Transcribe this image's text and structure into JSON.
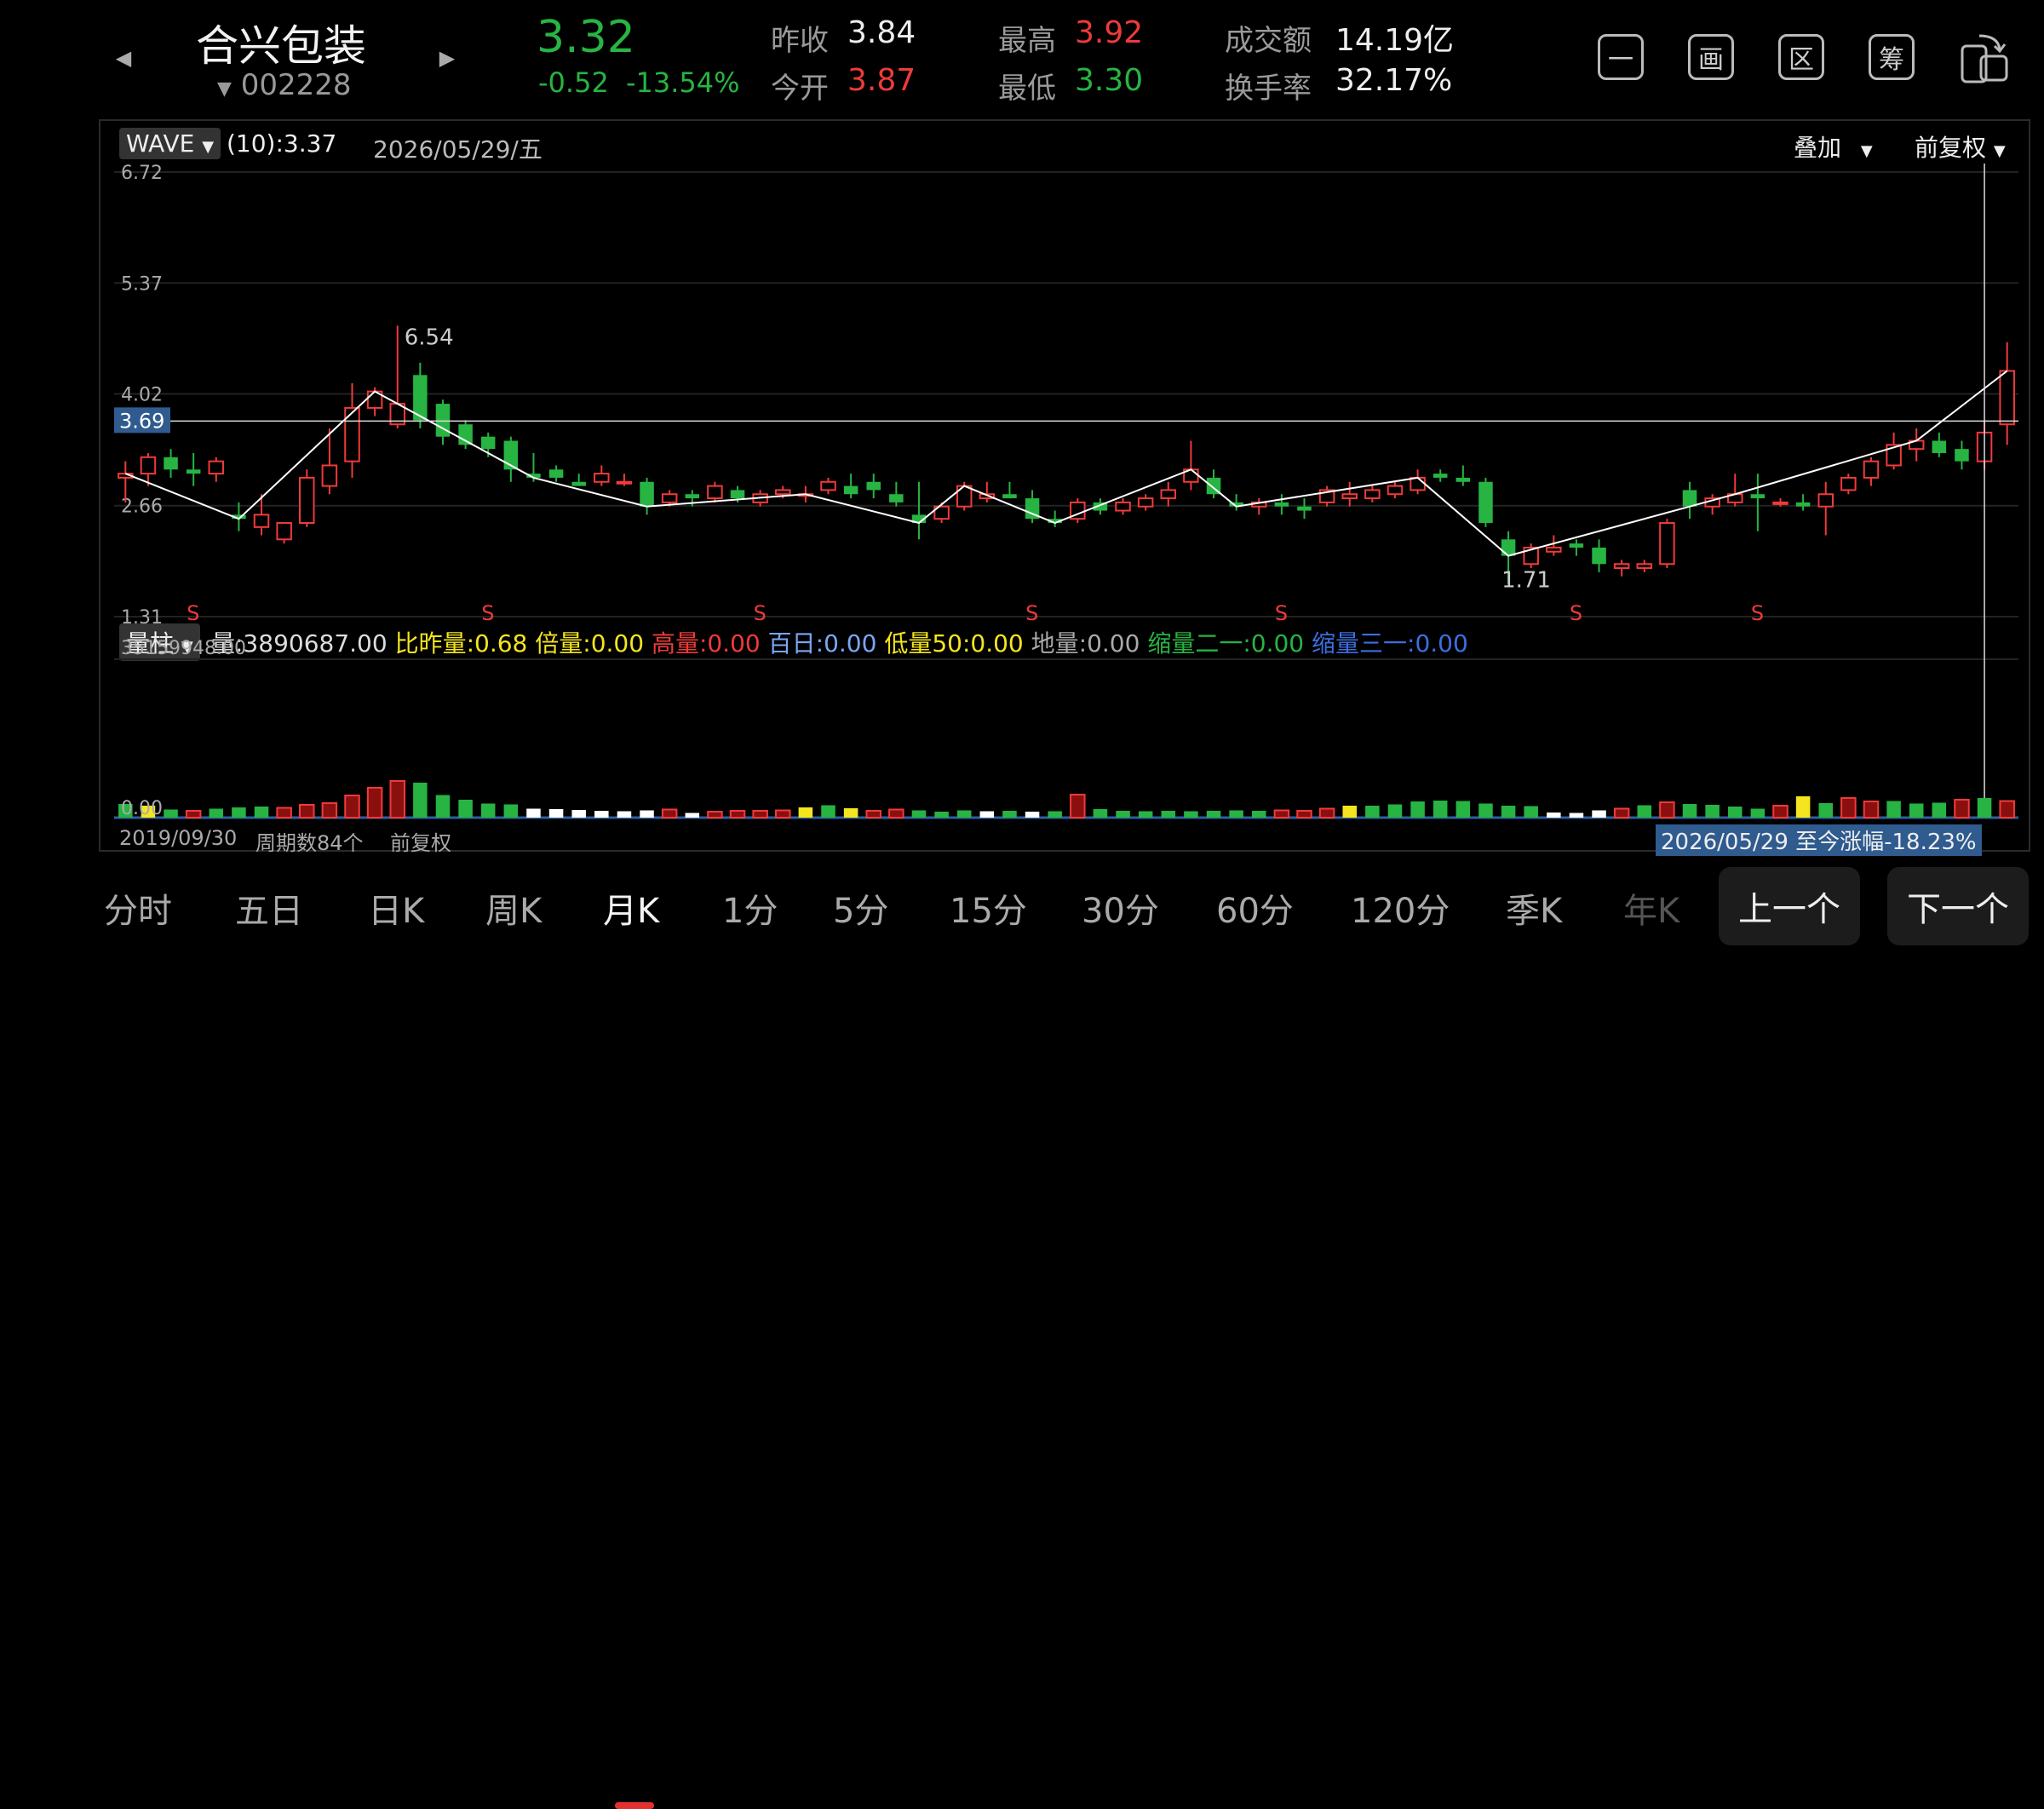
{
  "stock": {
    "name": "合兴包装",
    "code": "002228",
    "price": "3.32",
    "change": "-0.52",
    "change_pct": "-13.54%"
  },
  "quote": {
    "prev_close_label": "昨收",
    "prev_close": "3.84",
    "open_label": "今开",
    "open": "3.87",
    "high_label": "最高",
    "high": "3.92",
    "low_label": "最低",
    "low": "3.30",
    "turnover_label": "成交额",
    "turnover": "14.19亿",
    "turnover_rate_label": "换手率",
    "turnover_rate": "32.17%"
  },
  "toolbar": [
    "一",
    "画",
    "区",
    "筹"
  ],
  "colors": {
    "up": "#f03a3a",
    "down": "#27b443",
    "bg": "#000000",
    "zigzag": "#ffffff",
    "yellow": "#f5e51e",
    "label_bg": "#2f5b8f"
  },
  "main": {
    "indicator": "WAVE",
    "indicator_value": "(10):3.37",
    "date": "2026/05/29/五",
    "overlay_label": "叠加",
    "adjust_label": "前复权",
    "yticks": [
      "6.72",
      "5.37",
      "4.02",
      "2.66",
      "1.31"
    ],
    "crosshair_price": "3.69",
    "high_annotation": "6.54",
    "low_annotation": "1.71",
    "s_marker": "S"
  },
  "volume": {
    "selector": "量柱",
    "items": [
      {
        "text": "量:3890687.00",
        "color": "#dddddd"
      },
      {
        "text": "比昨量:0.68",
        "color": "#f5e51e"
      },
      {
        "text": "倍量:0.00",
        "color": "#f5e51e"
      },
      {
        "text": "高量:0.00",
        "color": "#f03a3a"
      },
      {
        "text": "百日:0.00",
        "color": "#7aa7f5"
      },
      {
        "text": "低量50:0.00",
        "color": "#f5e51e"
      },
      {
        "text": "地量:0.00",
        "color": "#aaaaaa"
      },
      {
        "text": "缩量二一:0.00",
        "color": "#27b443"
      },
      {
        "text": "缩量三一:0.00",
        "color": "#3b6fe0"
      }
    ],
    "max_label": "35159948.00",
    "zero_label": "0.00"
  },
  "footer": {
    "start_date": "2019/09/30",
    "periods": "周期数84个",
    "adjust": "前复权",
    "range_note": "2026/05/29 至今涨幅-18.23%"
  },
  "tabs": [
    {
      "label": "分时",
      "active": false
    },
    {
      "label": "五日",
      "active": false
    },
    {
      "label": "日K",
      "active": false
    },
    {
      "label": "周K",
      "active": false
    },
    {
      "label": "月K",
      "active": true
    },
    {
      "label": "1分",
      "active": false
    },
    {
      "label": "5分",
      "active": false
    },
    {
      "label": "15分",
      "active": false
    },
    {
      "label": "30分",
      "active": false
    },
    {
      "label": "60分",
      "active": false
    },
    {
      "label": "120分",
      "active": false
    },
    {
      "label": "季K",
      "active": false
    },
    {
      "label": "年K",
      "active": false
    }
  ],
  "buttons": {
    "prev": "上一个",
    "next": "下一个"
  },
  "chart_data": {
    "type": "candlestick",
    "ylim": [
      1.31,
      6.72
    ],
    "volume_ylim": [
      0,
      35159948
    ],
    "candles": [
      [
        3.0,
        3.2,
        2.7,
        3.05
      ],
      [
        3.05,
        3.3,
        2.9,
        3.25
      ],
      [
        3.25,
        3.35,
        3.0,
        3.1
      ],
      [
        3.1,
        3.3,
        2.9,
        3.05
      ],
      [
        3.05,
        3.25,
        2.95,
        3.2
      ],
      [
        2.55,
        2.7,
        2.35,
        2.5
      ],
      [
        2.4,
        2.8,
        2.3,
        2.55
      ],
      [
        2.25,
        2.45,
        2.2,
        2.45
      ],
      [
        2.45,
        3.1,
        2.4,
        3.0
      ],
      [
        2.9,
        3.6,
        2.8,
        3.15
      ],
      [
        3.2,
        4.15,
        3.0,
        3.85
      ],
      [
        3.85,
        4.1,
        3.75,
        4.05
      ],
      [
        3.65,
        4.85,
        3.6,
        3.9
      ],
      [
        4.25,
        4.4,
        3.6,
        3.7
      ],
      [
        3.9,
        3.95,
        3.4,
        3.5
      ],
      [
        3.65,
        3.7,
        3.35,
        3.4
      ],
      [
        3.5,
        3.55,
        3.25,
        3.35
      ],
      [
        3.45,
        3.5,
        2.95,
        3.1
      ],
      [
        3.05,
        3.3,
        2.95,
        3.0
      ],
      [
        3.1,
        3.15,
        2.95,
        3.0
      ],
      [
        2.95,
        3.05,
        2.9,
        2.9
      ],
      [
        2.95,
        3.15,
        2.9,
        3.05
      ],
      [
        2.95,
        3.05,
        2.9,
        2.95
      ],
      [
        2.95,
        3.0,
        2.55,
        2.65
      ],
      [
        2.7,
        2.85,
        2.65,
        2.8
      ],
      [
        2.8,
        2.85,
        2.65,
        2.75
      ],
      [
        2.75,
        2.95,
        2.7,
        2.9
      ],
      [
        2.85,
        2.9,
        2.7,
        2.75
      ],
      [
        2.7,
        2.85,
        2.65,
        2.8
      ],
      [
        2.8,
        2.9,
        2.75,
        2.85
      ],
      [
        2.8,
        2.9,
        2.7,
        2.8
      ],
      [
        2.85,
        3.0,
        2.8,
        2.95
      ],
      [
        2.9,
        3.05,
        2.75,
        2.8
      ],
      [
        2.95,
        3.05,
        2.75,
        2.85
      ],
      [
        2.8,
        2.95,
        2.65,
        2.7
      ],
      [
        2.55,
        2.95,
        2.25,
        2.45
      ],
      [
        2.5,
        2.7,
        2.45,
        2.65
      ],
      [
        2.65,
        2.95,
        2.6,
        2.9
      ],
      [
        2.75,
        2.95,
        2.7,
        2.8
      ],
      [
        2.8,
        2.95,
        2.75,
        2.75
      ],
      [
        2.75,
        2.85,
        2.45,
        2.5
      ],
      [
        2.5,
        2.6,
        2.4,
        2.45
      ],
      [
        2.5,
        2.75,
        2.45,
        2.7
      ],
      [
        2.7,
        2.75,
        2.55,
        2.6
      ],
      [
        2.6,
        2.75,
        2.55,
        2.7
      ],
      [
        2.65,
        2.8,
        2.6,
        2.75
      ],
      [
        2.75,
        2.95,
        2.65,
        2.85
      ],
      [
        2.95,
        3.45,
        2.85,
        3.1
      ],
      [
        3.0,
        3.1,
        2.75,
        2.8
      ],
      [
        2.7,
        2.8,
        2.6,
        2.65
      ],
      [
        2.65,
        2.75,
        2.55,
        2.7
      ],
      [
        2.7,
        2.8,
        2.55,
        2.65
      ],
      [
        2.65,
        2.75,
        2.5,
        2.6
      ],
      [
        2.7,
        2.9,
        2.65,
        2.85
      ],
      [
        2.75,
        2.95,
        2.65,
        2.8
      ],
      [
        2.75,
        2.9,
        2.7,
        2.85
      ],
      [
        2.8,
        2.95,
        2.75,
        2.9
      ],
      [
        2.85,
        3.1,
        2.8,
        3.0
      ],
      [
        3.05,
        3.1,
        2.95,
        3.0
      ],
      [
        3.0,
        3.15,
        2.9,
        2.95
      ],
      [
        2.95,
        3.0,
        2.4,
        2.45
      ],
      [
        2.25,
        2.35,
        1.71,
        2.05
      ],
      [
        1.95,
        2.2,
        1.9,
        2.15
      ],
      [
        2.1,
        2.3,
        2.05,
        2.15
      ],
      [
        2.2,
        2.25,
        2.05,
        2.15
      ],
      [
        2.15,
        2.25,
        1.85,
        1.95
      ],
      [
        1.9,
        2.0,
        1.8,
        1.95
      ],
      [
        1.9,
        2.0,
        1.85,
        1.95
      ],
      [
        1.95,
        2.5,
        1.9,
        2.45
      ],
      [
        2.85,
        2.95,
        2.5,
        2.65
      ],
      [
        2.65,
        2.8,
        2.55,
        2.75
      ],
      [
        2.7,
        3.05,
        2.65,
        2.8
      ],
      [
        2.8,
        3.05,
        2.35,
        2.75
      ],
      [
        2.7,
        2.75,
        2.65,
        2.7
      ],
      [
        2.7,
        2.8,
        2.6,
        2.65
      ],
      [
        2.65,
        2.95,
        2.3,
        2.8
      ],
      [
        2.85,
        3.05,
        2.8,
        3.0
      ],
      [
        3.0,
        3.25,
        2.9,
        3.2
      ],
      [
        3.15,
        3.55,
        3.1,
        3.4
      ],
      [
        3.35,
        3.6,
        3.2,
        3.45
      ],
      [
        3.45,
        3.55,
        3.25,
        3.3
      ],
      [
        3.35,
        3.45,
        3.1,
        3.2
      ],
      [
        3.2,
        3.7,
        3.1,
        3.55
      ],
      [
        3.65,
        4.65,
        3.4,
        4.3
      ]
    ],
    "volumes": [
      [
        3200000,
        "green"
      ],
      [
        2800000,
        "yellow"
      ],
      [
        1900000,
        "green"
      ],
      [
        1600000,
        "red"
      ],
      [
        2100000,
        "green"
      ],
      [
        2400000,
        "green"
      ],
      [
        2600000,
        "green"
      ],
      [
        2300000,
        "red"
      ],
      [
        3000000,
        "red"
      ],
      [
        3400000,
        "red"
      ],
      [
        5200000,
        "red"
      ],
      [
        7000000,
        "red"
      ],
      [
        8600000,
        "red"
      ],
      [
        8200000,
        "green"
      ],
      [
        5300000,
        "green"
      ],
      [
        4200000,
        "green"
      ],
      [
        3300000,
        "green"
      ],
      [
        3100000,
        "green"
      ],
      [
        2100000,
        "white"
      ],
      [
        2000000,
        "white"
      ],
      [
        1800000,
        "white"
      ],
      [
        1600000,
        "white"
      ],
      [
        1500000,
        "white"
      ],
      [
        1700000,
        "white"
      ],
      [
        1900000,
        "red"
      ],
      [
        1100000,
        "white"
      ],
      [
        1400000,
        "red"
      ],
      [
        1600000,
        "red"
      ],
      [
        1600000,
        "red"
      ],
      [
        1700000,
        "red"
      ],
      [
        2400000,
        "yellow"
      ],
      [
        2900000,
        "green"
      ],
      [
        2200000,
        "yellow"
      ],
      [
        1600000,
        "red"
      ],
      [
        1900000,
        "red"
      ],
      [
        1700000,
        "green"
      ],
      [
        1400000,
        "green"
      ],
      [
        1700000,
        "green"
      ],
      [
        1500000,
        "white"
      ],
      [
        1600000,
        "green"
      ],
      [
        1400000,
        "white"
      ],
      [
        1500000,
        "green"
      ],
      [
        5400000,
        "red"
      ],
      [
        2000000,
        "green"
      ],
      [
        1600000,
        "green"
      ],
      [
        1500000,
        "green"
      ],
      [
        1600000,
        "green"
      ],
      [
        1500000,
        "green"
      ],
      [
        1600000,
        "green"
      ],
      [
        1700000,
        "green"
      ],
      [
        1600000,
        "green"
      ],
      [
        1700000,
        "red"
      ],
      [
        1600000,
        "red"
      ],
      [
        2100000,
        "red"
      ],
      [
        2800000,
        "yellow"
      ],
      [
        2800000,
        "green"
      ],
      [
        3100000,
        "green"
      ],
      [
        3800000,
        "green"
      ],
      [
        4000000,
        "green"
      ],
      [
        3900000,
        "green"
      ],
      [
        3300000,
        "green"
      ],
      [
        2800000,
        "green"
      ],
      [
        2700000,
        "green"
      ],
      [
        1200000,
        "white"
      ],
      [
        1100000,
        "white"
      ],
      [
        1700000,
        "white"
      ],
      [
        2100000,
        "red"
      ],
      [
        2900000,
        "green"
      ],
      [
        3600000,
        "red"
      ],
      [
        3200000,
        "green"
      ],
      [
        3000000,
        "green"
      ],
      [
        2600000,
        "green"
      ],
      [
        2100000,
        "green"
      ],
      [
        2800000,
        "red"
      ],
      [
        5000000,
        "yellow"
      ],
      [
        3400000,
        "green"
      ],
      [
        4600000,
        "red"
      ],
      [
        3800000,
        "red"
      ],
      [
        3900000,
        "green"
      ],
      [
        3300000,
        "green"
      ],
      [
        3500000,
        "green"
      ],
      [
        4200000,
        "red"
      ],
      [
        4600000,
        "green"
      ],
      [
        3890687,
        "red"
      ]
    ]
  }
}
